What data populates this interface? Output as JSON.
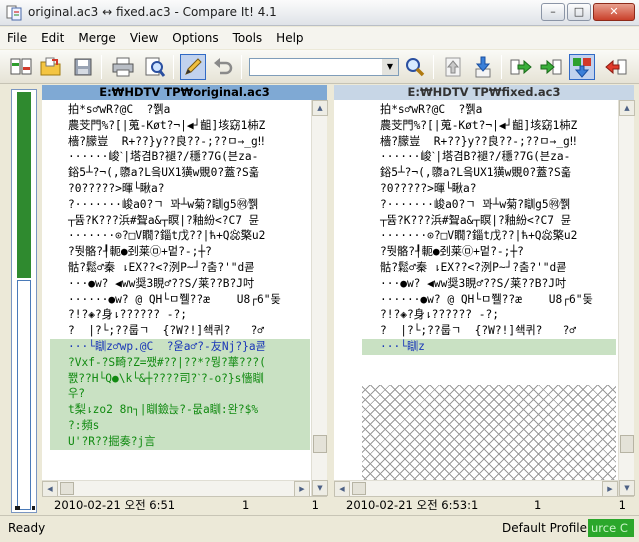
{
  "window": {
    "title": "original.ac3 ↔ fixed.ac3 - Compare It! 4.1"
  },
  "window_controls": {
    "minimize": "–",
    "maximize": "□",
    "close": "✕"
  },
  "menu": [
    "File",
    "Edit",
    "Merge",
    "View",
    "Options",
    "Tools",
    "Help"
  ],
  "toolbar": {
    "search_value": "",
    "icons": [
      "compare-icon",
      "open-folder-icon",
      "save-icon",
      "print-icon",
      "preview-icon",
      "edit-pencil-icon",
      "undo-icon",
      "find-icon",
      "first-diff-icon",
      "prev-diff-icon",
      "copy-left-icon",
      "copy-right-icon",
      "merge-down-icon",
      "next-diff-icon"
    ]
  },
  "left": {
    "header": "E:₩HDTV TP₩original.ac3",
    "lines": [
      "拍*s♂wR?@C  ?쮉a",
      "農芠門%?[|蒐-Køt?¬|◀┘齟]垓窈1枾Z",
      "檣?朦豈  R+??}y??良??-;??ㅁ→_g‼",
      "······峻ˋ|塔겸B?褪?/穩?7G(븐za-",
      "鋊5┴?¬(,隳a?L읔UX1獚w覞0?蓋?S훏",
      "?0?????>暉└瞅a?",
      "?·······峻a0?ㄱ 꽈┴w菊?瞓g5㉽쮉",
      "┬뜜?K???浜#聟a&┬瞑|?釉紛<?C7 뮨",
      "·······⊙?□V瞯?錙t戊??|ћ+Q惢檠u2",
      "?뛋骼?┦軛●刭莱㉤+멑?-;┼?",
      "骷?鬆♂秦 ⇂EX??<?洌P~┘?춤?'\"d쿋",
      "···●w? ◀ww奨3睍♂??S/莱??B?J吋",
      "······●w? @ QH└ㅁ쮈??æ    U8┌6\"돚",
      "?!?◈?身⇂?????? -?;",
      "?  |?└;??룹ㄱ  {?W?!]쇅퀴?   ?♂"
    ],
    "diff_lines": [
      "···└瞓z♂wp.@C  ?욷a♂?-友Nj?}a쿋",
      "?Vxf-?S畸?Z=쨌#??|??*?뭥?蕐???(",
      "쬀??H└Q●\\k└&┼????司?ˋ?-o?}s懎瞓",
      "우?",
      "t梨⇂zo2 8n┐|瞓鐱늕?-뭆a瞓:완?$%",
      "?:頻s",
      "U'?R??掘奏?j言"
    ],
    "footer": {
      "date": "2010-02-21  오전 6:51",
      "col1": "1",
      "col2": "1"
    }
  },
  "right": {
    "header": "E:₩HDTV TP₩fixed.ac3",
    "lines": [
      "拍*s♂wR?@C  ?쮉a",
      "農芠門%?[|蒐-Køt?¬|◀┘齟]垓窈1枾Z",
      "檣?朦豈  R+??}y??良??-;??ㅁ→_g‼",
      "······峻ˋ|塔겸B?褪?/穩?7G(븐za-",
      "鋊5┴?¬(,隳a?L읔UX1獚w覞0?蓋?S훏",
      "?0?????>暉└瞅a?",
      "?·······峻a0?ㄱ 꽈┴w菊?瞓g5㉽쮉",
      "┬뜜?K???浜#聟a&┬瞑|?釉紛<?C7 뮨",
      "·······⊙?□V瞯?錙t戊??|ћ+Q惢檠u2",
      "?뛋骼?┦軛●刭莱㉤+멑?-;┼?",
      "骷?鬆♂秦 ⇂EX??<?洌P~┘?춤?'\"d쿋",
      "···●w? ◀ww奨3睍♂??S/莱??B?J吋",
      "······●w? @ QH└ㅁ쮈??æ    U8┌6\"돚",
      "?!?◈?身⇂?????? -?;",
      "?  |?└;??룹ㄱ  {?W?!]쇅퀴?   ?♂"
    ],
    "diff_lines": [
      "···└瞓z"
    ],
    "footer": {
      "date": "2010-02-21  오전 6:53:1",
      "col1": "1",
      "col2": "1"
    }
  },
  "status": {
    "ready": "Ready",
    "profile": "Default Profile",
    "source": "urce C"
  },
  "colors": {
    "diff_bg": "#c9e1c3",
    "overview_green": "#2f8a2f",
    "left_header": "#7fa9d4",
    "right_header": "#c7d6e6"
  }
}
